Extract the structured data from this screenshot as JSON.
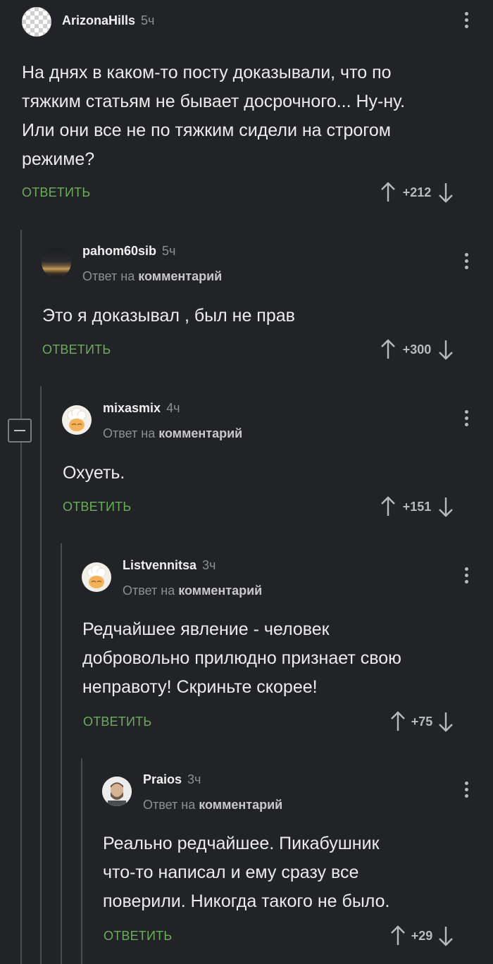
{
  "comments": [
    {
      "user": "ArizonaHills",
      "time": "5ч",
      "avatar": "checkered-placeholder-avatar",
      "text": "На днях в каком-то посту доказывали, что по\nтяжким статьям не бывает досрочного... Ну-ну.\nИли они все не по тяжким сидели на строгом\nрежиме?",
      "reply_label": "ОТВЕТИТЬ",
      "score": "+212"
    },
    {
      "user": "pahom60sib",
      "time": "5ч",
      "avatar": "night-city-avatar",
      "reply_prefix": "Ответ на",
      "reply_target": "комментарий",
      "text": "Это я доказывал , был не прав",
      "reply_label": "ОТВЕТИТЬ",
      "score": "+300"
    },
    {
      "user": "mixasmix",
      "time": "4ч",
      "avatar": "cook-avatar",
      "reply_prefix": "Ответ на",
      "reply_target": "комментарий",
      "text": "Охуеть.",
      "reply_label": "ОТВЕТИТЬ",
      "score": "+151"
    },
    {
      "user": "Listvennitsa",
      "time": "3ч",
      "avatar": "cook-avatar",
      "reply_prefix": "Ответ на",
      "reply_target": "комментарий",
      "text": "Редчайшее явление - человек\nдобровольно  прилюдно признает свою\nнеправоту! Скриньте скорее!",
      "reply_label": "ОТВЕТИТЬ",
      "score": "+75"
    },
    {
      "user": "Praios",
      "time": "3ч",
      "avatar": "bearded-man-avatar",
      "reply_prefix": "Ответ на",
      "reply_target": "комментарий",
      "text": "Реально редчайшее. Пикабушник\nчто-то написал и ему сразу все\nповерили. Никогда такого не было.",
      "reply_label": "ОТВЕТИТЬ",
      "score": "+29"
    }
  ],
  "colors": {
    "background": "#222326",
    "reply_button": "#6bad5a",
    "muted_text": "#8e8f93",
    "thread_line": "#4a4b4f"
  }
}
